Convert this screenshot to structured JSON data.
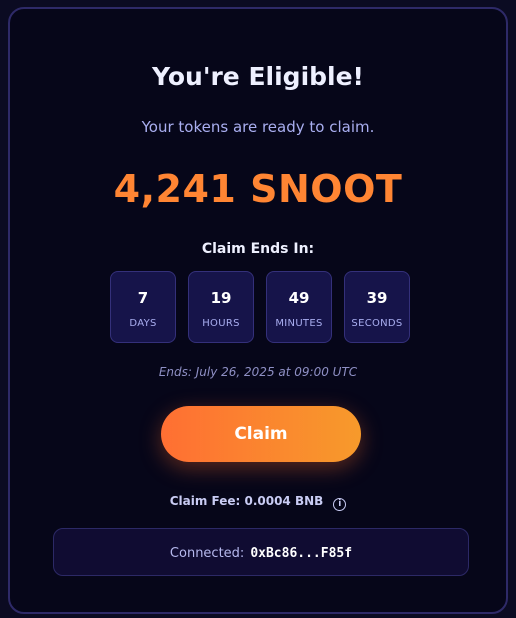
{
  "header": {
    "title": "You're Eligible!",
    "subtitle": "Your tokens are ready to claim."
  },
  "claim_amount": "4,241 SNOOT",
  "countdown": {
    "label": "Claim Ends In:",
    "units": [
      {
        "value": "7",
        "unit": "DAYS"
      },
      {
        "value": "19",
        "unit": "HOURS"
      },
      {
        "value": "49",
        "unit": "MINUTES"
      },
      {
        "value": "39",
        "unit": "SECONDS"
      }
    ],
    "end_text": "Ends: July 26, 2025 at 09:00 UTC"
  },
  "claim_button": {
    "label": "Claim"
  },
  "fee": {
    "text": "Claim Fee: 0.0004 BNB",
    "info_icon": "i"
  },
  "wallet": {
    "label": "Connected:",
    "address": "0xBc86...F85f"
  },
  "colors": {
    "accent": "#ff8533",
    "button_start": "#ff6f33",
    "button_end": "#f79a2b",
    "card_border": "#2e2a68"
  }
}
